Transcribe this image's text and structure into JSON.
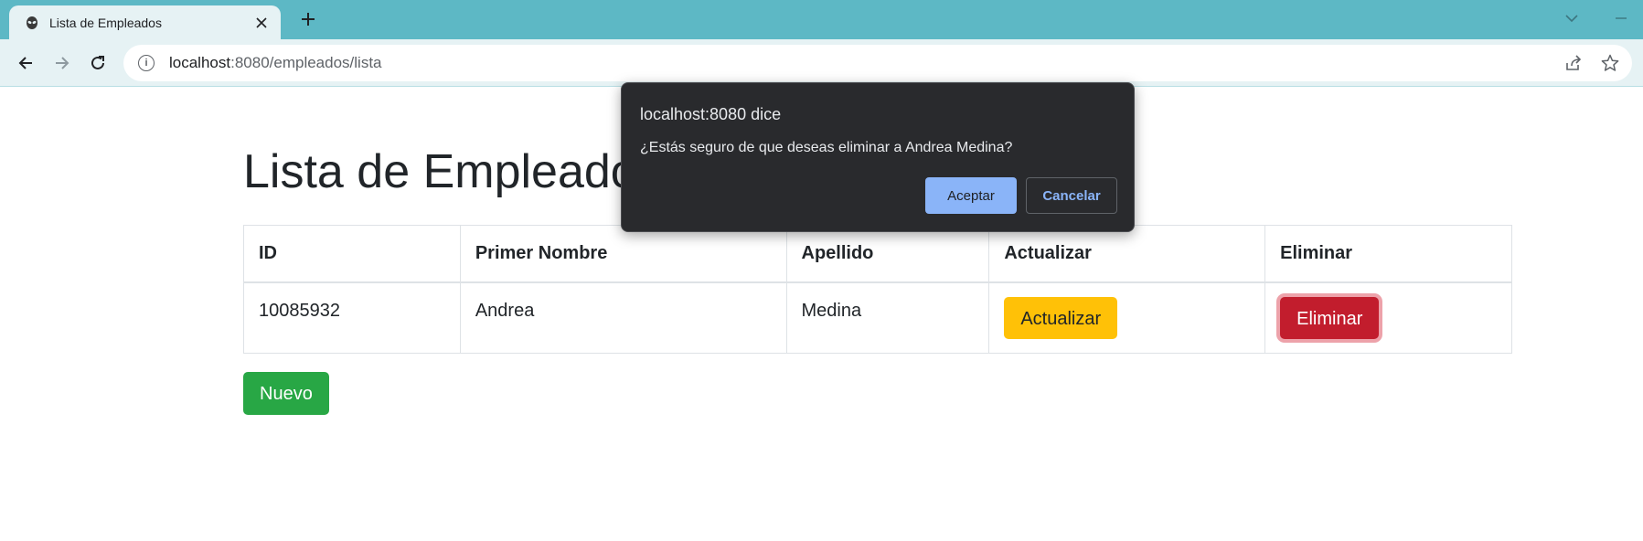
{
  "browser": {
    "tab_title": "Lista de Empleados",
    "url_host": "localhost",
    "url_path": ":8080/empleados/lista"
  },
  "page": {
    "title": "Lista de Empleados",
    "table": {
      "headers": [
        "ID",
        "Primer Nombre",
        "Apellido",
        "Actualizar",
        "Eliminar"
      ],
      "rows": [
        {
          "id": "10085932",
          "first_name": "Andrea",
          "last_name": "Medina",
          "update_label": "Actualizar",
          "delete_label": "Eliminar"
        }
      ]
    },
    "new_button": "Nuevo"
  },
  "dialog": {
    "title": "localhost:8080 dice",
    "message": "¿Estás seguro de que deseas eliminar a Andrea Medina?",
    "ok_label": "Aceptar",
    "cancel_label": "Cancelar"
  },
  "colors": {
    "tab_strip": "#5db8c5",
    "warning": "#ffc107",
    "danger": "#c21d2d",
    "success": "#28a745",
    "dialog_bg": "#292a2d",
    "dialog_accent": "#8ab4f8"
  },
  "icons": [
    "alien-favicon-icon",
    "close-icon",
    "plus-icon",
    "chevron-down-icon",
    "minimize-icon",
    "back-arrow-icon",
    "forward-arrow-icon",
    "reload-icon",
    "info-icon",
    "share-icon",
    "star-icon"
  ]
}
